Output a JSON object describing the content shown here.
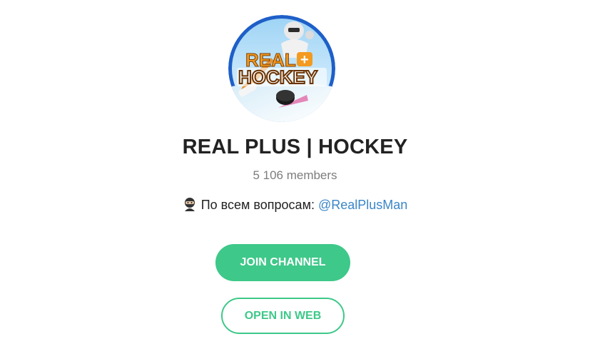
{
  "channel": {
    "name": "REAL PLUS | HOCKEY",
    "members": "5 106 members",
    "avatar_text": "REAL + HOCKEY",
    "description": {
      "icon": "ninja-emoji",
      "text": "По всем вопросам: ",
      "link_text": "@RealPlusMan"
    }
  },
  "actions": {
    "join_label": "JOIN CHANNEL",
    "open_web_label": "OPEN IN WEB"
  },
  "colors": {
    "accent_green": "#3ec889",
    "link_blue": "#3a86c8",
    "title_text": "#222222",
    "muted_text": "#7d7d7d",
    "avatar_ring": "#1e5fc8"
  }
}
